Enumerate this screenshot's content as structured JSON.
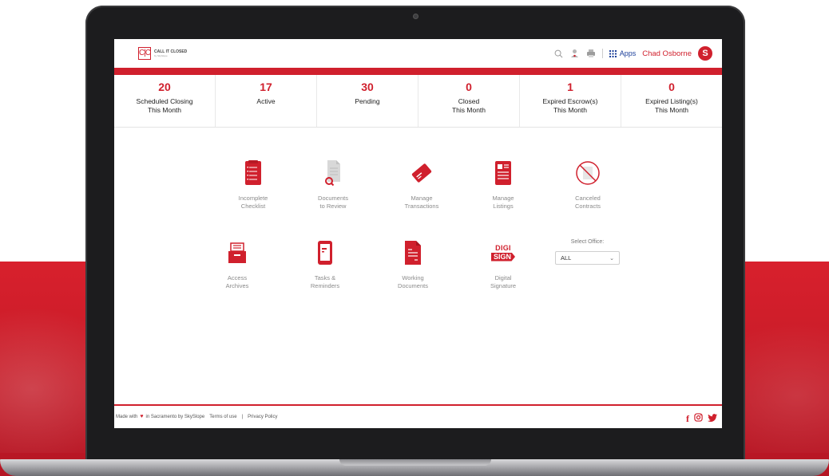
{
  "app": {
    "logo_mark": "C|C",
    "logo_text": "CALL IT CLOSED",
    "logo_sub": "by SkySlope",
    "apps_label": "Apps",
    "user_name": "Chad Osborne",
    "user_logo": "S"
  },
  "stats": [
    {
      "value": "20",
      "label": "Scheduled Closing\nThis Month"
    },
    {
      "value": "17",
      "label": "Active"
    },
    {
      "value": "30",
      "label": "Pending"
    },
    {
      "value": "0",
      "label": "Closed\nThis Month"
    },
    {
      "value": "1",
      "label": "Expired Escrow(s)\nThis Month"
    },
    {
      "value": "0",
      "label": "Expired Listing(s)\nThis Month"
    }
  ],
  "tiles": {
    "incomplete_checklist": "Incomplete\nChecklist",
    "documents_to_review": "Documents\nto Review",
    "manage_transactions": "Manage\nTransactions",
    "manage_listings": "Manage\nListings",
    "canceled_contracts": "Canceled\nContracts",
    "access_archives": "Access\nArchives",
    "tasks_reminders": "Tasks &\nReminders",
    "working_documents": "Working\nDocuments",
    "digital_signature": "Digital\nSignature",
    "digi_line1": "DIGI",
    "digi_line2": "SIGN"
  },
  "office": {
    "label": "Select Office:",
    "selected": "ALL"
  },
  "footer": {
    "made_with": "Made with",
    "in_text": "in Sacramento by SkySlope",
    "terms": "Terms of use",
    "divider": "|",
    "privacy": "Privacy Policy"
  },
  "colors": {
    "accent": "#d0202d",
    "apps_blue": "#1c3f9a"
  },
  "icons": [
    "search-icon",
    "user-icon",
    "print-icon",
    "apps-grid-icon",
    "facebook-icon",
    "instagram-icon",
    "twitter-icon"
  ]
}
